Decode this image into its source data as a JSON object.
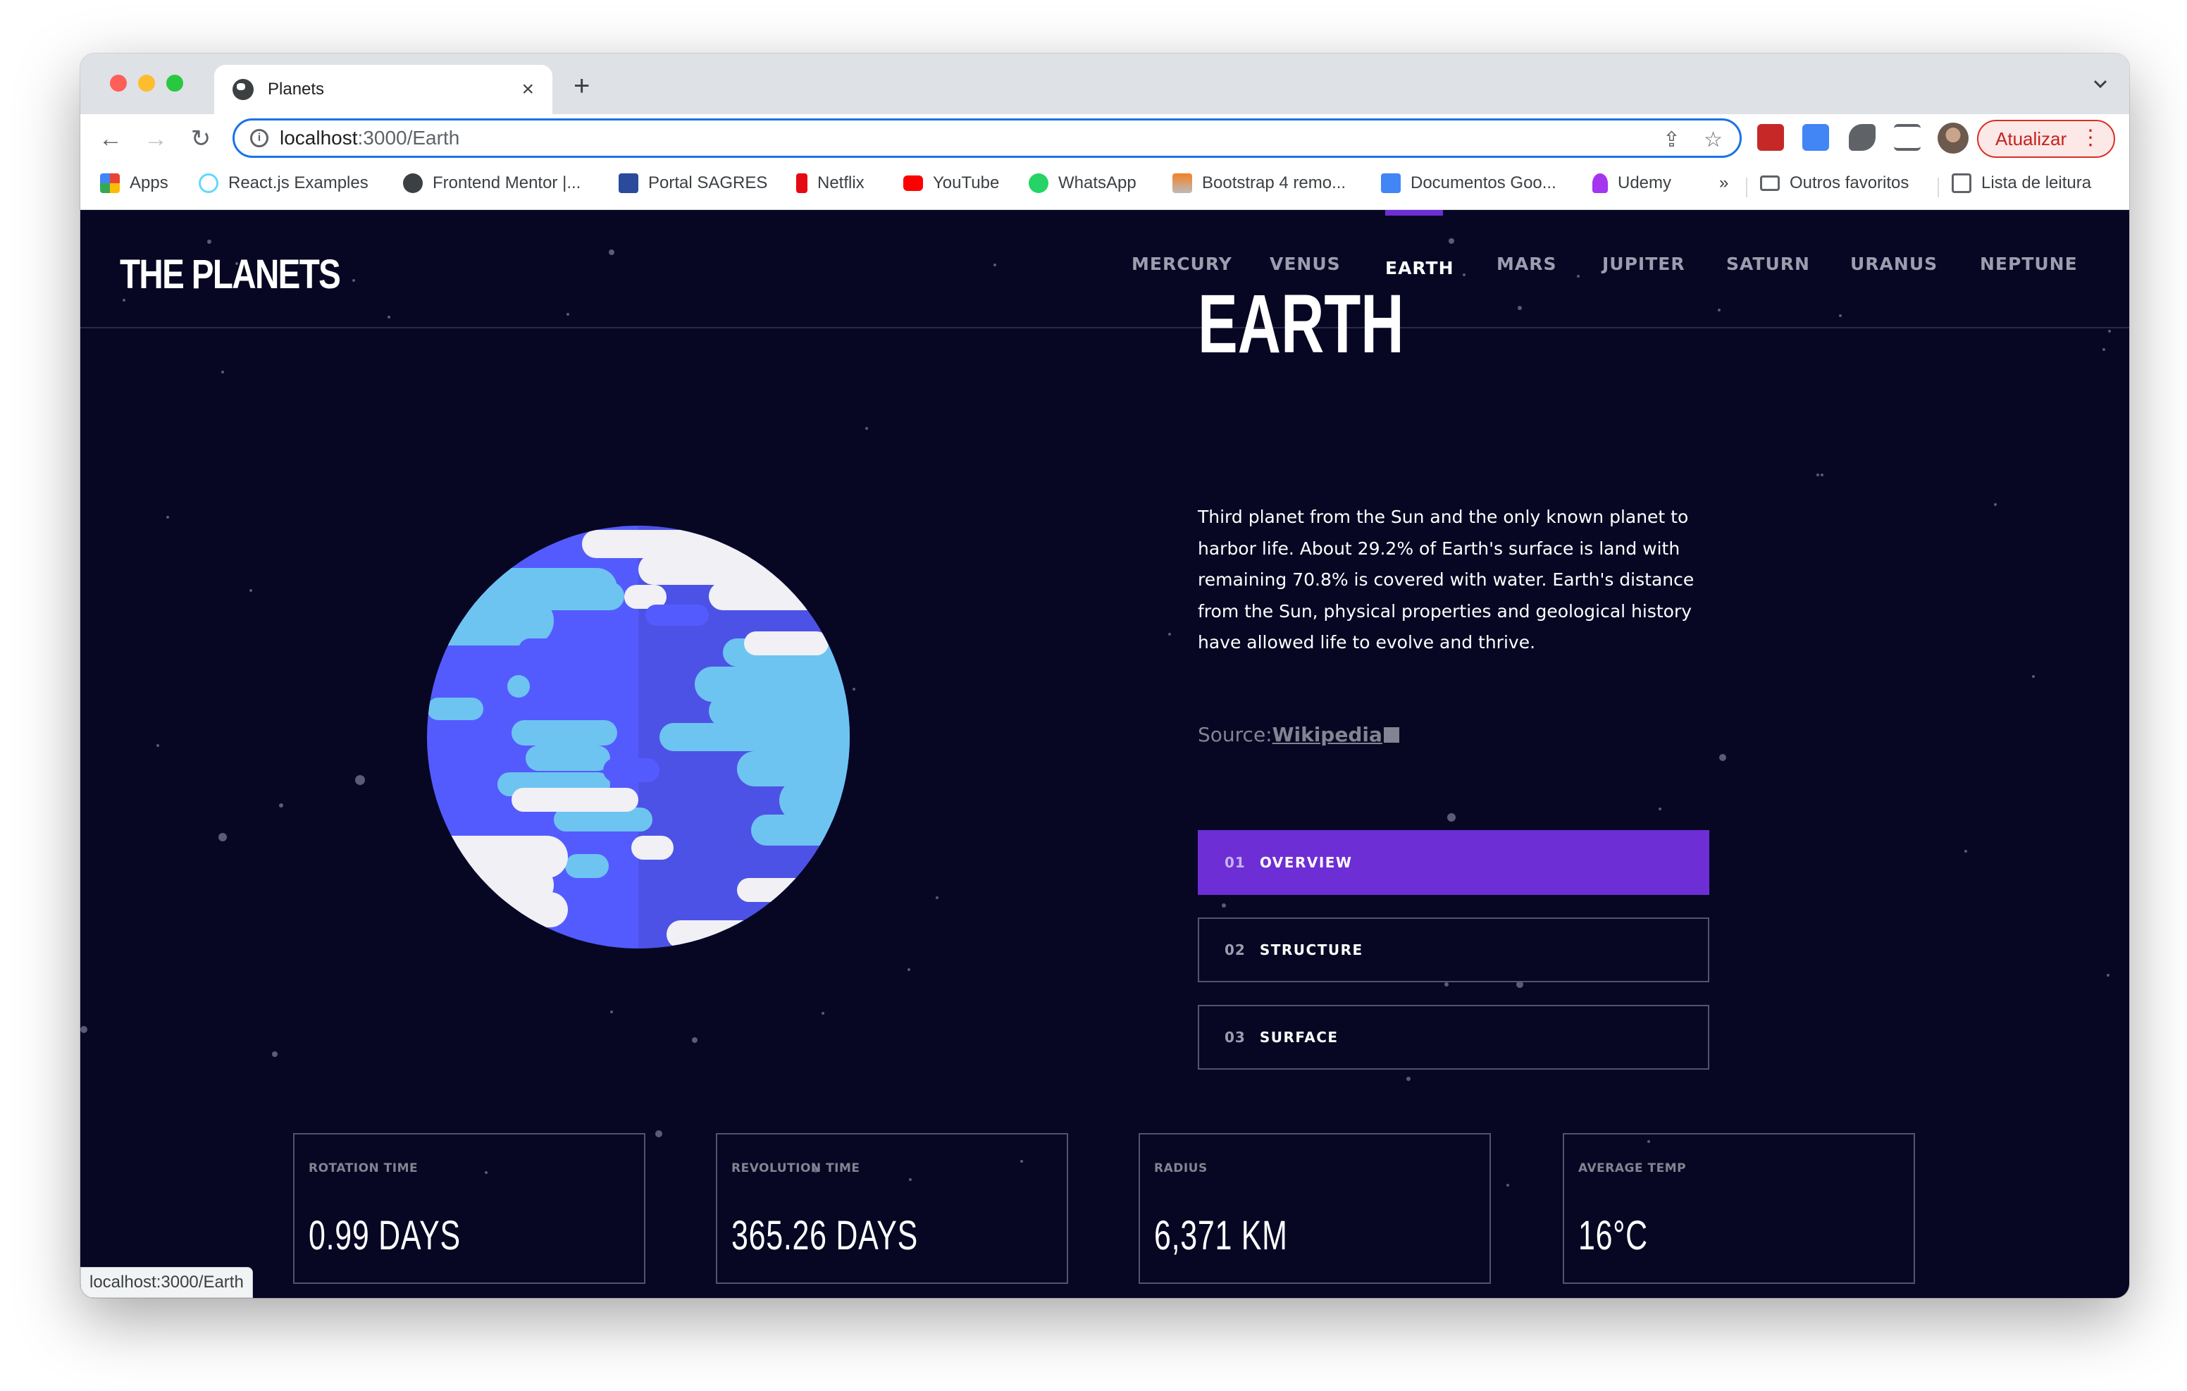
{
  "browser": {
    "tab_title": "Planets",
    "new_tab": "+",
    "url_host": "localhost",
    "url_rest": ":3000/Earth",
    "update_label": "Atualizar",
    "bookmarks": [
      {
        "label": "Apps",
        "icon": "apps-grid-icon"
      },
      {
        "label": "React.js Examples",
        "icon": "react-icon"
      },
      {
        "label": "Frontend Mentor |...",
        "icon": "frontend-mentor-icon"
      },
      {
        "label": "Portal SAGRES",
        "icon": "sagres-icon"
      },
      {
        "label": "Netflix",
        "icon": "netflix-icon"
      },
      {
        "label": "YouTube",
        "icon": "youtube-icon"
      },
      {
        "label": "WhatsApp",
        "icon": "whatsapp-icon"
      },
      {
        "label": "Bootstrap 4 remo...",
        "icon": "stackoverflow-icon"
      },
      {
        "label": "Documentos Goo...",
        "icon": "google-docs-icon"
      },
      {
        "label": "Udemy",
        "icon": "udemy-icon"
      }
    ],
    "more_bookmarks": "»",
    "other_bookmarks": "Outros favoritos",
    "reading_list": "Lista de leitura",
    "status_url": "localhost:3000/Earth"
  },
  "site": {
    "logo": "THE PLANETS",
    "nav": [
      "MERCURY",
      "VENUS",
      "EARTH",
      "MARS",
      "JUPITER",
      "SATURN",
      "URANUS",
      "NEPTUNE"
    ],
    "active_planet": "EARTH",
    "planet": {
      "name": "EARTH",
      "description": "Third planet from the Sun and the only known planet to harbor life. About 29.2% of Earth's surface is land with remaining 70.8% is covered with water. Earth's distance from the Sun, physical properties and geological history have allowed life to evolve and thrive.",
      "source_label": "Source:",
      "source_link": "Wikipedia"
    },
    "views": [
      {
        "num": "01",
        "label": "OVERVIEW",
        "active": true
      },
      {
        "num": "02",
        "label": "STRUCTURE",
        "active": false
      },
      {
        "num": "03",
        "label": "SURFACE",
        "active": false
      }
    ],
    "stats": [
      {
        "label": "ROTATION TIME",
        "value": "0.99 DAYS"
      },
      {
        "label": "REVOLUTION TIME",
        "value": "365.26 DAYS"
      },
      {
        "label": "RADIUS",
        "value": "6,371 KM"
      },
      {
        "label": "AVERAGE TEMP",
        "value": "16°C"
      }
    ]
  },
  "colors": {
    "background": "#070724",
    "accent": "#6d2ed5",
    "planet_blue": "#545bfe",
    "planet_cyan": "#6ec4f1",
    "planet_white": "#f0f0f5"
  }
}
